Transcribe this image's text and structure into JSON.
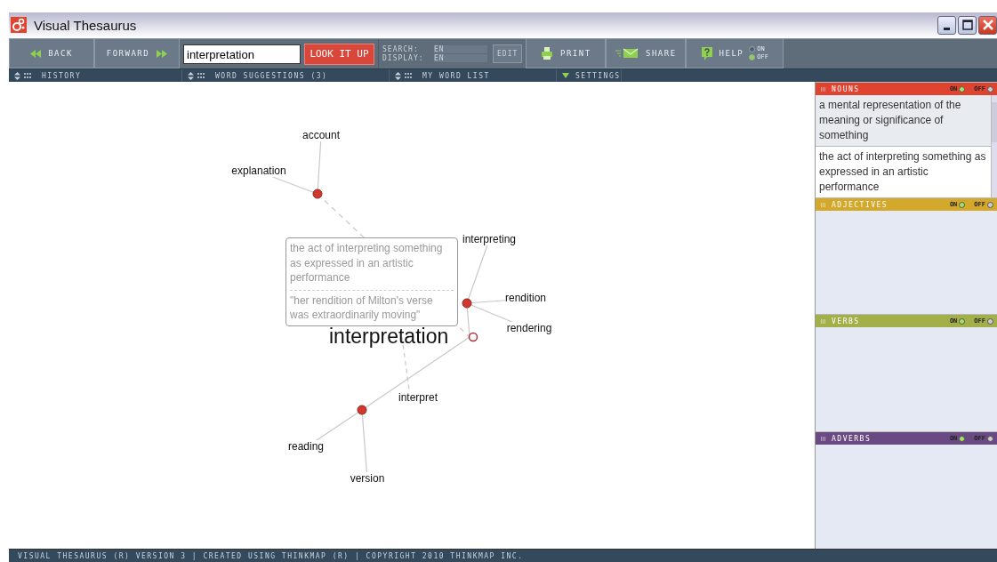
{
  "window": {
    "title": "Visual Thesaurus"
  },
  "toolbar": {
    "back": "BACK",
    "forward": "FORWARD",
    "search_value": "interpretation",
    "lookup": "LOOK IT UP",
    "search_label": "SEARCH:",
    "search_lang": "EN",
    "display_label": "DISPLAY:",
    "display_lang": "EN",
    "edit": "EDIT",
    "print": "PRINT",
    "share": "SHARE",
    "help": "HELP",
    "help_options": [
      {
        "label": "ON",
        "selected": false
      },
      {
        "label": "OFF",
        "selected": true
      }
    ]
  },
  "subbar": [
    {
      "label": "HISTORY",
      "kind": "arrows"
    },
    {
      "label": "WORD SUGGESTIONS (3)",
      "kind": "arrows"
    },
    {
      "label": "MY WORD LIST",
      "kind": "arrows"
    },
    {
      "label": "SETTINGS",
      "kind": "caret"
    }
  ],
  "graph": {
    "center": "interpretation",
    "meanings": [
      {
        "words": [
          "account",
          "explanation"
        ]
      },
      {
        "words": [
          "interpreting",
          "rendition",
          "rendering"
        ]
      },
      {
        "words": [
          "reading",
          "version"
        ]
      }
    ],
    "related": [
      "interpret"
    ],
    "tooltip": {
      "definition": "the act of interpreting something as expressed in an artistic performance",
      "example": "\"her rendition of Milton's verse was extraordinarily moving\""
    }
  },
  "panels": [
    {
      "title": "NOUNS",
      "color": "#e0432f",
      "on_label": "ON",
      "off_label": "OFF",
      "on": true,
      "definitions": [
        {
          "text": "a mental representation of the meaning or significance of something",
          "selected": false
        },
        {
          "text": "the act of interpreting something as expressed in an artistic performance",
          "selected": true
        }
      ]
    },
    {
      "title": "ADJECTIVES",
      "color": "#d4a82a",
      "on_label": "ON",
      "off_label": "OFF",
      "on": true
    },
    {
      "title": "VERBS",
      "color": "#a3b04a",
      "on_label": "ON",
      "off_label": "OFF",
      "on": true
    },
    {
      "title": "ADVERBS",
      "color": "#6a4a82",
      "on_label": "ON",
      "off_label": "OFF",
      "on": true
    }
  ],
  "status_bar": "VISUAL THESAURUS (R) VERSION 3 | CREATED USING THINKMAP (R) | COPYRIGHT 2010 THINKMAP INC."
}
